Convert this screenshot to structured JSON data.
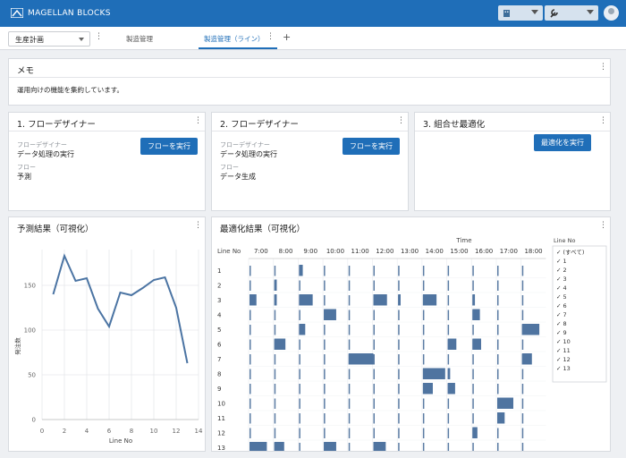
{
  "header": {
    "brand": "MAGELLAN BLOCKS",
    "brand_color": "#1f6eb8"
  },
  "tabs": {
    "project_select": "生産計画",
    "items": [
      {
        "label": "製造管理"
      },
      {
        "label": "製造管理（ライン）",
        "active": true
      }
    ],
    "add": "+"
  },
  "memo": {
    "title": "メモ",
    "text": "運用向けの機能を集約しています。"
  },
  "cards": [
    {
      "title": "1. フローデザイナー",
      "designer_label": "フローデザイナー",
      "designer_value": "データ処理の実行",
      "flow_label": "フロー",
      "flow_value": "予測",
      "button": "フローを実行"
    },
    {
      "title": "2. フローデザイナー",
      "designer_label": "フローデザイナー",
      "designer_value": "データ処理の実行",
      "flow_label": "フロー",
      "flow_value": "データ生成",
      "button": "フローを実行"
    },
    {
      "title": "3. 組合せ最適化",
      "button": "最適化を実行"
    }
  ],
  "forecast": {
    "title": "予測結果（可視化）"
  },
  "optimization": {
    "title": "最適化結果（可視化）"
  },
  "chart_data": [
    {
      "type": "line",
      "title": "予測結果（可視化）",
      "xlabel": "Line No",
      "ylabel": "発注数",
      "x": [
        1,
        2,
        3,
        4,
        5,
        6,
        7,
        8,
        9,
        10,
        11,
        12,
        13
      ],
      "y": [
        140,
        183,
        155,
        158,
        124,
        104,
        142,
        139,
        147,
        156,
        159,
        125,
        63
      ],
      "xlim": [
        0,
        14
      ],
      "ylim": [
        0,
        190
      ],
      "xticks": [
        "0",
        "2",
        "4",
        "6",
        "8",
        "10",
        "12",
        "14"
      ],
      "yticks": [
        "0",
        "50",
        "100",
        "150"
      ],
      "grid": true
    },
    {
      "type": "gantt",
      "title": "最適化結果（可視化）",
      "xlabel": "Time",
      "ylabel": "Line No",
      "hours": [
        "7:00",
        "8:00",
        "9:00",
        "10:00",
        "11:00",
        "12:00",
        "13:00",
        "14:00",
        "15:00",
        "16:00",
        "17:00",
        "18:00"
      ],
      "lines": [
        "1",
        "2",
        "3",
        "4",
        "5",
        "6",
        "7",
        "8",
        "9",
        "10",
        "11",
        "12",
        "13"
      ],
      "legend_title": "Line No",
      "legend_items": [
        "(すべて)",
        "1",
        "2",
        "3",
        "4",
        "5",
        "6",
        "7",
        "8",
        "9",
        "10",
        "11",
        "12",
        "13"
      ]
    }
  ]
}
